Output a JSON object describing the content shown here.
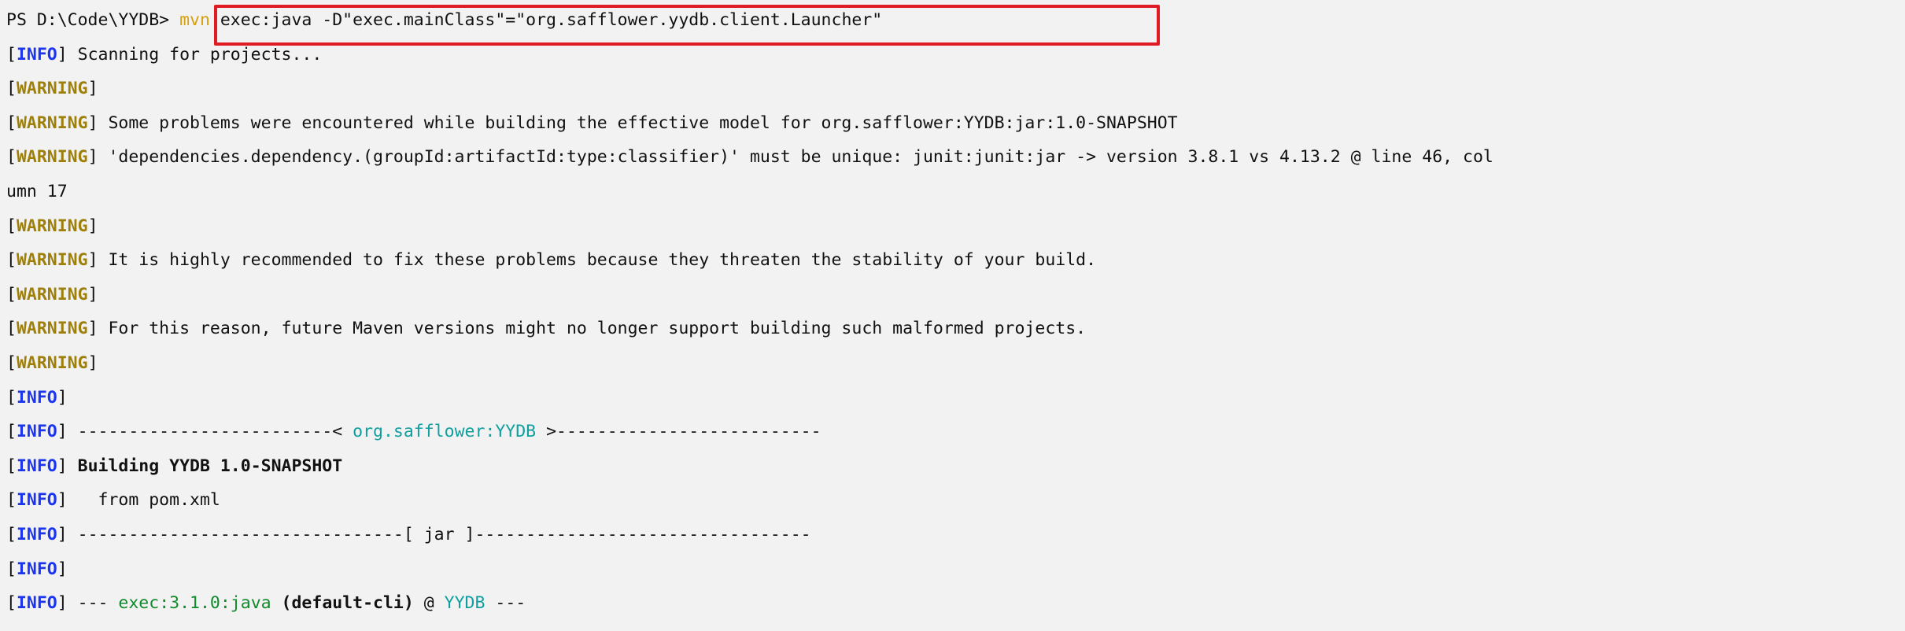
{
  "terminal": {
    "shell_prompt": "PS D:\\Code\\YYDB>",
    "command_name": "mvn",
    "command_args": " exec:java -D\"exec.mainClass\"=\"org.safflower.yydb.client.Launcher\"",
    "colors": {
      "background": "#f2f2f2",
      "foreground": "#111111",
      "info_tag": "#1b35ef",
      "warning_tag": "#9d7f0a",
      "command_accent": "#d6a012",
      "project_teal": "#0f9f9f",
      "plugin_green": "#118a2b",
      "annotation_red": "#e01b24"
    },
    "annotation": {
      "name": "command-highlight-box",
      "shape": "rectangle",
      "color": "#e01b24"
    },
    "tags": {
      "info": "[INFO]",
      "warning": "[WARNING]",
      "open_bracket": "[",
      "close_bracket": "]",
      "info_label": "INFO",
      "warning_label": "WARNING"
    },
    "lines": [
      {
        "id": "prompt-line",
        "tokens": [
          {
            "text": "PS D:\\Code\\YYDB>",
            "style": "default"
          },
          {
            "text": " ",
            "style": "default"
          },
          {
            "text": "mvn",
            "style": "cmd"
          },
          {
            "text": " exec:java -D\"exec.mainClass\"=\"org.safflower.yydb.client.Launcher\"",
            "style": "default"
          }
        ]
      },
      {
        "id": "info-scanning",
        "tokens": [
          {
            "text": "[",
            "style": "bracket"
          },
          {
            "text": "INFO",
            "style": "info"
          },
          {
            "text": "]",
            "style": "bracket"
          },
          {
            "text": " Scanning for projects...",
            "style": "default"
          }
        ]
      },
      {
        "id": "warning-blank-1",
        "tokens": [
          {
            "text": "[",
            "style": "bracket"
          },
          {
            "text": "WARNING",
            "style": "warning"
          },
          {
            "text": "]",
            "style": "bracket"
          }
        ]
      },
      {
        "id": "warning-some-problems",
        "tokens": [
          {
            "text": "[",
            "style": "bracket"
          },
          {
            "text": "WARNING",
            "style": "warning"
          },
          {
            "text": "]",
            "style": "bracket"
          },
          {
            "text": " Some problems were encountered while building the effective model for org.safflower:YYDB:jar:1.0-SNAPSHOT",
            "style": "default"
          }
        ]
      },
      {
        "id": "warning-duplicate-dependency",
        "tokens": [
          {
            "text": "[",
            "style": "bracket"
          },
          {
            "text": "WARNING",
            "style": "warning"
          },
          {
            "text": "]",
            "style": "bracket"
          },
          {
            "text": " 'dependencies.dependency.(groupId:artifactId:type:classifier)' must be unique: junit:junit:jar -> version 3.8.1 vs 4.13.2 @ line 46, col",
            "style": "default"
          }
        ]
      },
      {
        "id": "warning-duplicate-dependency-wrap",
        "tokens": [
          {
            "text": "umn 17",
            "style": "default"
          }
        ]
      },
      {
        "id": "warning-blank-2",
        "tokens": [
          {
            "text": "[",
            "style": "bracket"
          },
          {
            "text": "WARNING",
            "style": "warning"
          },
          {
            "text": "]",
            "style": "bracket"
          }
        ]
      },
      {
        "id": "warning-highly-recommended",
        "tokens": [
          {
            "text": "[",
            "style": "bracket"
          },
          {
            "text": "WARNING",
            "style": "warning"
          },
          {
            "text": "]",
            "style": "bracket"
          },
          {
            "text": " It is highly recommended to fix these problems because they threaten the stability of your build.",
            "style": "default"
          }
        ]
      },
      {
        "id": "warning-blank-3",
        "tokens": [
          {
            "text": "[",
            "style": "bracket"
          },
          {
            "text": "WARNING",
            "style": "warning"
          },
          {
            "text": "]",
            "style": "bracket"
          }
        ]
      },
      {
        "id": "warning-future-maven",
        "tokens": [
          {
            "text": "[",
            "style": "bracket"
          },
          {
            "text": "WARNING",
            "style": "warning"
          },
          {
            "text": "]",
            "style": "bracket"
          },
          {
            "text": " For this reason, future Maven versions might no longer support building such malformed projects.",
            "style": "default"
          }
        ]
      },
      {
        "id": "warning-blank-4",
        "tokens": [
          {
            "text": "[",
            "style": "bracket"
          },
          {
            "text": "WARNING",
            "style": "warning"
          },
          {
            "text": "]",
            "style": "bracket"
          }
        ]
      },
      {
        "id": "info-blank-1",
        "tokens": [
          {
            "text": "[",
            "style": "bracket"
          },
          {
            "text": "INFO",
            "style": "info"
          },
          {
            "text": "]",
            "style": "bracket"
          }
        ]
      },
      {
        "id": "info-project-banner",
        "tokens": [
          {
            "text": "[",
            "style": "bracket"
          },
          {
            "text": "INFO",
            "style": "info"
          },
          {
            "text": "]",
            "style": "bracket"
          },
          {
            "text": " -------------------------< ",
            "style": "dash"
          },
          {
            "text": "org.safflower:YYDB",
            "style": "teal"
          },
          {
            "text": " >--------------------------",
            "style": "dash"
          }
        ]
      },
      {
        "id": "info-building",
        "tokens": [
          {
            "text": "[",
            "style": "bracket"
          },
          {
            "text": "INFO",
            "style": "info"
          },
          {
            "text": "]",
            "style": "bracket"
          },
          {
            "text": " ",
            "style": "default"
          },
          {
            "text": "Building YYDB 1.0-SNAPSHOT",
            "style": "bold"
          }
        ]
      },
      {
        "id": "info-from-pom",
        "tokens": [
          {
            "text": "[",
            "style": "bracket"
          },
          {
            "text": "INFO",
            "style": "info"
          },
          {
            "text": "]",
            "style": "bracket"
          },
          {
            "text": "   from pom.xml",
            "style": "default"
          }
        ]
      },
      {
        "id": "info-packaging-banner",
        "tokens": [
          {
            "text": "[",
            "style": "bracket"
          },
          {
            "text": "INFO",
            "style": "info"
          },
          {
            "text": "]",
            "style": "bracket"
          },
          {
            "text": " --------------------------------[ ",
            "style": "dash"
          },
          {
            "text": "jar",
            "style": "default"
          },
          {
            "text": " ]---------------------------------",
            "style": "dash"
          }
        ]
      },
      {
        "id": "info-blank-2",
        "tokens": [
          {
            "text": "[",
            "style": "bracket"
          },
          {
            "text": "INFO",
            "style": "info"
          },
          {
            "text": "]",
            "style": "bracket"
          }
        ]
      },
      {
        "id": "info-exec-goal",
        "tokens": [
          {
            "text": "[",
            "style": "bracket"
          },
          {
            "text": "INFO",
            "style": "info"
          },
          {
            "text": "]",
            "style": "bracket"
          },
          {
            "text": " --- ",
            "style": "dash"
          },
          {
            "text": "exec:3.1.0:java",
            "style": "green"
          },
          {
            "text": " ",
            "style": "default"
          },
          {
            "text": "(default-cli)",
            "style": "bold"
          },
          {
            "text": " @ ",
            "style": "default"
          },
          {
            "text": "YYDB",
            "style": "teal"
          },
          {
            "text": " ---",
            "style": "dash"
          }
        ]
      }
    ]
  }
}
